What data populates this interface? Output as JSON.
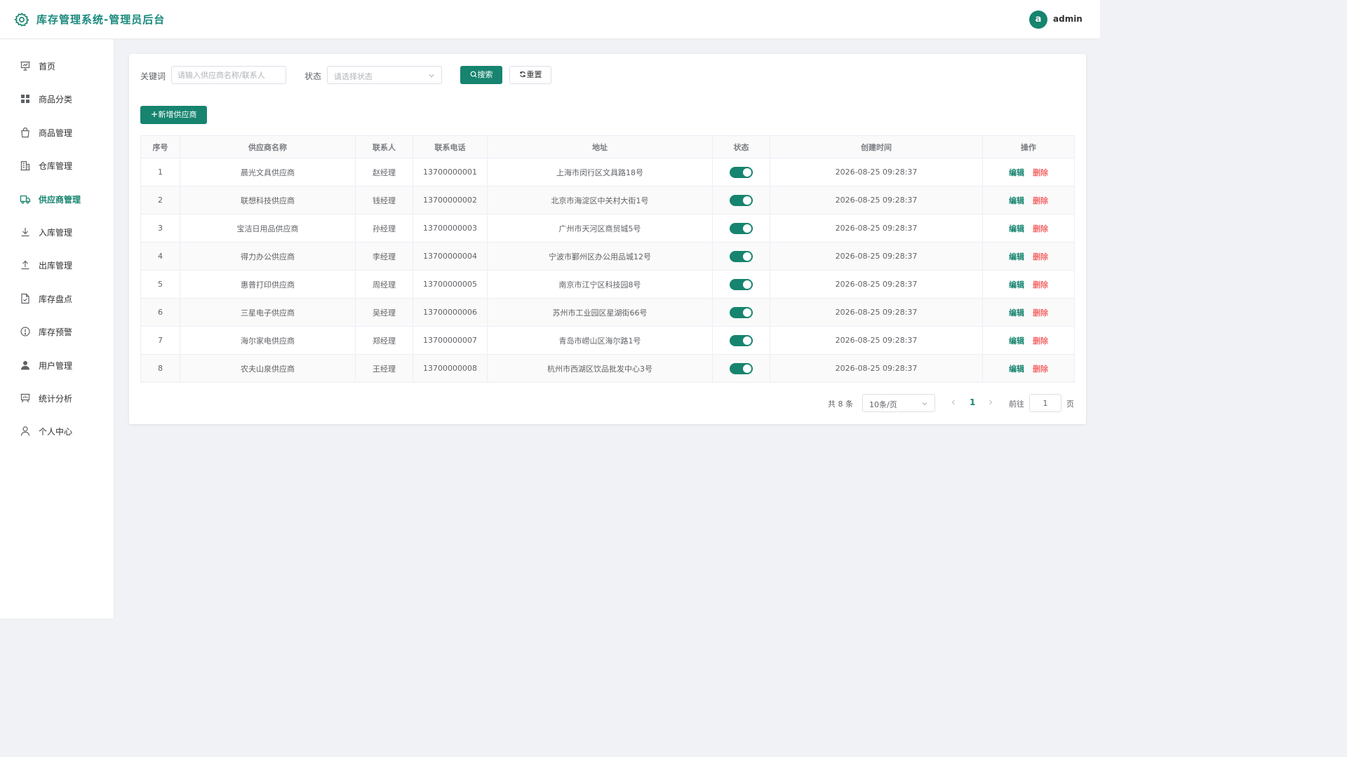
{
  "header": {
    "title": "库存管理系统-管理员后台",
    "avatar_letter": "a",
    "username": "admin"
  },
  "colors": {
    "primary": "#16846f",
    "danger": "#f56c6c",
    "title": "#1a8a7d"
  },
  "sidebar": {
    "active": "供应商管理",
    "items": [
      {
        "label": "首页",
        "icon": "presentation-icon"
      },
      {
        "label": "商品分类",
        "icon": "grid-icon"
      },
      {
        "label": "商品管理",
        "icon": "shopping-bag-icon"
      },
      {
        "label": "仓库管理",
        "icon": "office-building-icon"
      },
      {
        "label": "供应商管理",
        "icon": "truck-icon"
      },
      {
        "label": "入库管理",
        "icon": "download-icon"
      },
      {
        "label": "出库管理",
        "icon": "upload-icon"
      },
      {
        "label": "库存盘点",
        "icon": "document-checked-icon"
      },
      {
        "label": "库存预警",
        "icon": "warning-icon"
      },
      {
        "label": "用户管理",
        "icon": "user-filled-icon"
      },
      {
        "label": "统计分析",
        "icon": "data-board-icon"
      },
      {
        "label": "个人中心",
        "icon": "user-icon"
      }
    ]
  },
  "filters": {
    "keyword_label": "关键词",
    "keyword_placeholder": "请输入供应商名称/联系人",
    "keyword_value": "",
    "status_label": "状态",
    "status_placeholder": "请选择状态",
    "search_label": "搜索",
    "reset_label": "重置"
  },
  "toolbar": {
    "add_label": "新增供应商"
  },
  "table": {
    "columns": [
      "序号",
      "供应商名称",
      "联系人",
      "联系电话",
      "地址",
      "状态",
      "创建时间",
      "操作"
    ],
    "edit_label": "编辑",
    "delete_label": "删除",
    "rows": [
      {
        "index": "1",
        "name": "晨光文具供应商",
        "contact": "赵经理",
        "phone": "13700000001",
        "address": "上海市闵行区文具路18号",
        "enabled": true,
        "created": "2026-08-25 09:28:37"
      },
      {
        "index": "2",
        "name": "联想科技供应商",
        "contact": "钱经理",
        "phone": "13700000002",
        "address": "北京市海淀区中关村大街1号",
        "enabled": true,
        "created": "2026-08-25 09:28:37"
      },
      {
        "index": "3",
        "name": "宝洁日用品供应商",
        "contact": "孙经理",
        "phone": "13700000003",
        "address": "广州市天河区商贸城5号",
        "enabled": true,
        "created": "2026-08-25 09:28:37"
      },
      {
        "index": "4",
        "name": "得力办公供应商",
        "contact": "李经理",
        "phone": "13700000004",
        "address": "宁波市鄞州区办公用品城12号",
        "enabled": true,
        "created": "2026-08-25 09:28:37"
      },
      {
        "index": "5",
        "name": "惠普打印供应商",
        "contact": "周经理",
        "phone": "13700000005",
        "address": "南京市江宁区科技园8号",
        "enabled": true,
        "created": "2026-08-25 09:28:37"
      },
      {
        "index": "6",
        "name": "三星电子供应商",
        "contact": "吴经理",
        "phone": "13700000006",
        "address": "苏州市工业园区星湖街66号",
        "enabled": true,
        "created": "2026-08-25 09:28:37"
      },
      {
        "index": "7",
        "name": "海尔家电供应商",
        "contact": "郑经理",
        "phone": "13700000007",
        "address": "青岛市崂山区海尔路1号",
        "enabled": true,
        "created": "2026-08-25 09:28:37"
      },
      {
        "index": "8",
        "name": "农夫山泉供应商",
        "contact": "王经理",
        "phone": "13700000008",
        "address": "杭州市西湖区饮品批发中心3号",
        "enabled": true,
        "created": "2026-08-25 09:28:37"
      }
    ]
  },
  "pagination": {
    "total_text": "共 8 条",
    "page_size": "10条/页",
    "current_page": "1",
    "goto_label": "前往",
    "goto_value": "1",
    "page_suffix": "页"
  }
}
